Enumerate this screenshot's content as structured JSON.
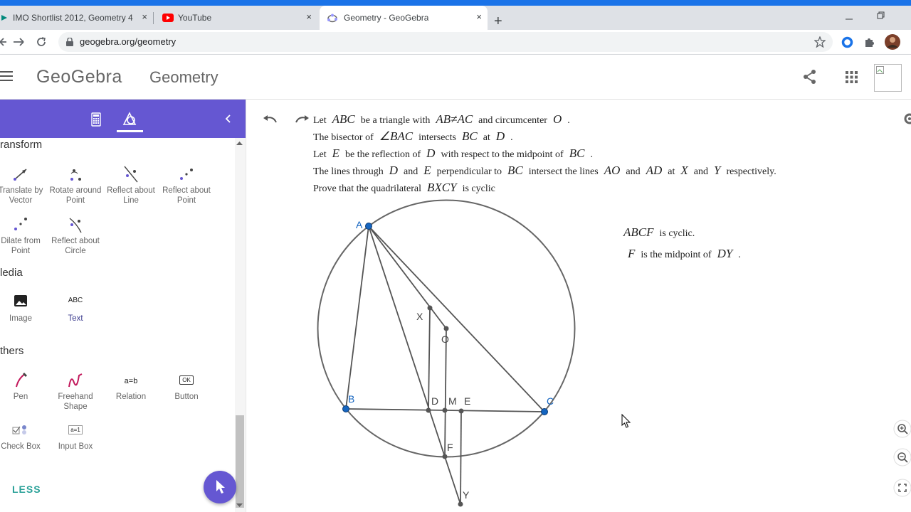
{
  "browser": {
    "tabs": [
      {
        "title": "IMO Shortlist 2012, Geometry 4"
      },
      {
        "title": "YouTube"
      },
      {
        "title": "Geometry - GeoGebra"
      }
    ],
    "url": "geogebra.org/geometry",
    "close_glyph": "×",
    "new_tab_glyph": "+"
  },
  "header": {
    "brand": "GeoGebra",
    "app_title": "Geometry"
  },
  "toolbox": {
    "sections": {
      "transform": "ransform",
      "media": "ledia",
      "others": "thers"
    },
    "transform_tools": [
      {
        "label1": "Translate by",
        "label2": "Vector"
      },
      {
        "label1": "Rotate around",
        "label2": "Point"
      },
      {
        "label1": "Reflect about",
        "label2": "Line"
      },
      {
        "label1": "Reflect about",
        "label2": "Point"
      },
      {
        "label1": "Dilate from",
        "label2": "Point"
      },
      {
        "label1": "Reflect about",
        "label2": "Circle"
      }
    ],
    "media_tools": [
      {
        "label": "Image"
      },
      {
        "label": "Text",
        "icon_text": "ABC"
      }
    ],
    "other_tools": [
      {
        "label1": "Pen",
        "label2": ""
      },
      {
        "label1": "Freehand",
        "label2": "Shape"
      },
      {
        "label1": "Relation",
        "label2": "",
        "icon_text": "a=b"
      },
      {
        "label1": "Button",
        "label2": "",
        "icon_text": "OK"
      },
      {
        "label1": "Check Box",
        "label2": ""
      },
      {
        "label1": "Input Box",
        "label2": "",
        "icon_text": "a=1"
      }
    ],
    "less": "LESS"
  },
  "problem": {
    "l1": {
      "a": "Let",
      "m1": "ABC",
      "b": "be a triangle with",
      "m2": "AB≠AC",
      "c": "and circumcenter",
      "m3": "O",
      "d": "."
    },
    "l2": {
      "a": "The bisector of",
      "m1": "∠BAC",
      "b": "intersects",
      "m2": "BC",
      "c": "at",
      "m3": "D",
      "d": "."
    },
    "l3": {
      "a": "Let",
      "m1": "E",
      "b": "be the reflection of",
      "m2": "D",
      "c": "with respect to the midpoint of",
      "m3": "BC",
      "d": "."
    },
    "l4": {
      "a": "The lines through",
      "m1": "D",
      "b": "and",
      "m2": "E",
      "c": "perpendicular to",
      "m3": "BC",
      "d": "intersect the lines",
      "m4": "AO",
      "e": "and",
      "m5": "AD",
      "f": "at",
      "m6": "X",
      "g": "and",
      "m7": "Y",
      "h": "respectively."
    },
    "l5": {
      "a": "Prove that the quadrilateral",
      "m1": "BXCY",
      "b": "is cyclic"
    }
  },
  "notes": {
    "n1": {
      "m1": "ABCF",
      "a": "is cyclic."
    },
    "n2": {
      "m1": "F",
      "a": "is the midpoint of",
      "m2": "DY",
      "b": "."
    }
  },
  "points": {
    "A": "A",
    "B": "B",
    "C": "C",
    "D": "D",
    "M": "M",
    "E": "E",
    "X": "X",
    "O": "O",
    "F": "F",
    "Y": "Y"
  },
  "colors": {
    "accent": "#6557d2",
    "point_free": "#1565c0",
    "point_dependent": "#555555",
    "line": "#555555"
  }
}
